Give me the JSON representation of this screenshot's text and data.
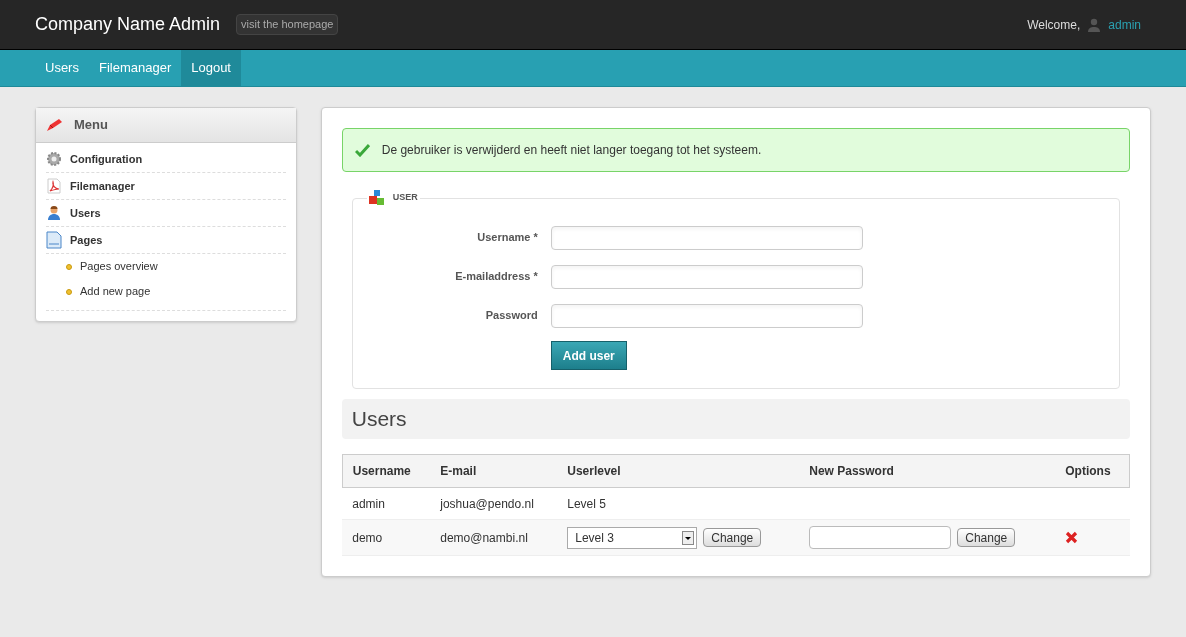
{
  "header": {
    "title": "Company Name Admin",
    "homepage_link": "visit the homepage",
    "welcome": "Welcome,",
    "user": "admin"
  },
  "nav": [
    {
      "label": "Users",
      "selected": false
    },
    {
      "label": "Filemanager",
      "selected": false
    },
    {
      "label": "Logout",
      "selected": true
    }
  ],
  "sidebar": {
    "title": "Menu",
    "items": [
      {
        "label": "Configuration",
        "kind": "gear"
      },
      {
        "label": "Filemanager",
        "kind": "pdf"
      },
      {
        "label": "Users",
        "kind": "user"
      },
      {
        "label": "Pages",
        "kind": "page",
        "children": [
          {
            "label": "Pages overview"
          },
          {
            "label": "Add new page"
          }
        ]
      }
    ]
  },
  "alert": {
    "kind": "success",
    "text": "De gebruiker is verwijderd en heeft niet langer toegang tot het systeem."
  },
  "form": {
    "legend": "USER",
    "fields": [
      {
        "label": "Username *"
      },
      {
        "label": "E-mailaddress *"
      },
      {
        "label": "Password"
      }
    ],
    "submit": "Add user"
  },
  "users": {
    "title": "Users",
    "columns": [
      "Username",
      "E-mail",
      "Userlevel",
      "New Password",
      "Options"
    ],
    "rows": [
      {
        "kind": "static",
        "username": "admin",
        "email": "joshua@pendo.nl",
        "level": "Level 5"
      },
      {
        "kind": "editable",
        "username": "demo",
        "email": "demo@nambi.nl",
        "level": "Level 3",
        "change_level": "Change",
        "change_password": "Change"
      }
    ]
  }
}
